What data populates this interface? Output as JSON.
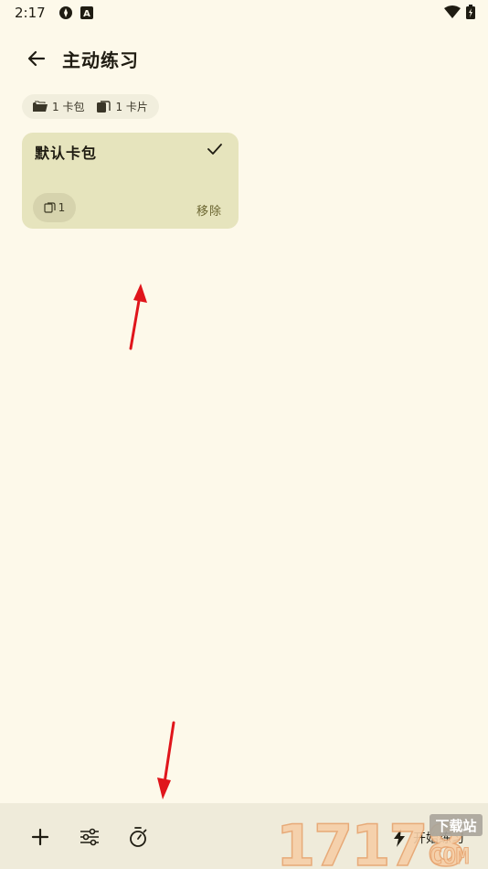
{
  "status_bar": {
    "time": "2:17"
  },
  "app_bar": {
    "title": "主动练习"
  },
  "summary": {
    "decks_count": "1 卡包",
    "cards_count": "1 卡片"
  },
  "deck": {
    "name": "默认卡包",
    "card_count": "1",
    "remove_label": "移除"
  },
  "bottom_bar": {
    "start_label": "开始练习"
  },
  "watermark": {
    "text": "17178",
    "tag": "下载站",
    "domain": "COM"
  },
  "colors": {
    "background": "#fdf9ea",
    "card": "#e6e4bd",
    "bottom_bar": "#efebda",
    "annotation_arrow": "#e0151b"
  }
}
